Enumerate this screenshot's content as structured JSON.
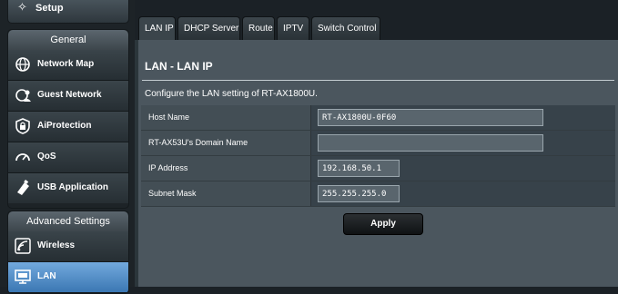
{
  "sidebar": {
    "setup_label": "Setup",
    "general_title": "General",
    "general_items": [
      {
        "label": "Network Map"
      },
      {
        "label": "Guest Network"
      },
      {
        "label": "AiProtection"
      },
      {
        "label": "QoS"
      },
      {
        "label": "USB Application"
      }
    ],
    "advanced_title": "Advanced Settings",
    "advanced_items": [
      {
        "label": "Wireless"
      },
      {
        "label": "LAN"
      }
    ]
  },
  "tabs": [
    {
      "label": "LAN IP"
    },
    {
      "label": "DHCP Server"
    },
    {
      "label": "Route"
    },
    {
      "label": "IPTV"
    },
    {
      "label": "Switch Control"
    }
  ],
  "page": {
    "title": "LAN - LAN IP",
    "description": "Configure the LAN setting of RT-AX1800U.",
    "fields": [
      {
        "label": "Host Name",
        "value": "RT-AX1800U-0F60"
      },
      {
        "label": "RT-AX53U's Domain Name",
        "value": ""
      },
      {
        "label": "IP Address",
        "value": "192.168.50.1"
      },
      {
        "label": "Subnet Mask",
        "value": "255.255.255.0"
      }
    ],
    "apply_label": "Apply"
  }
}
